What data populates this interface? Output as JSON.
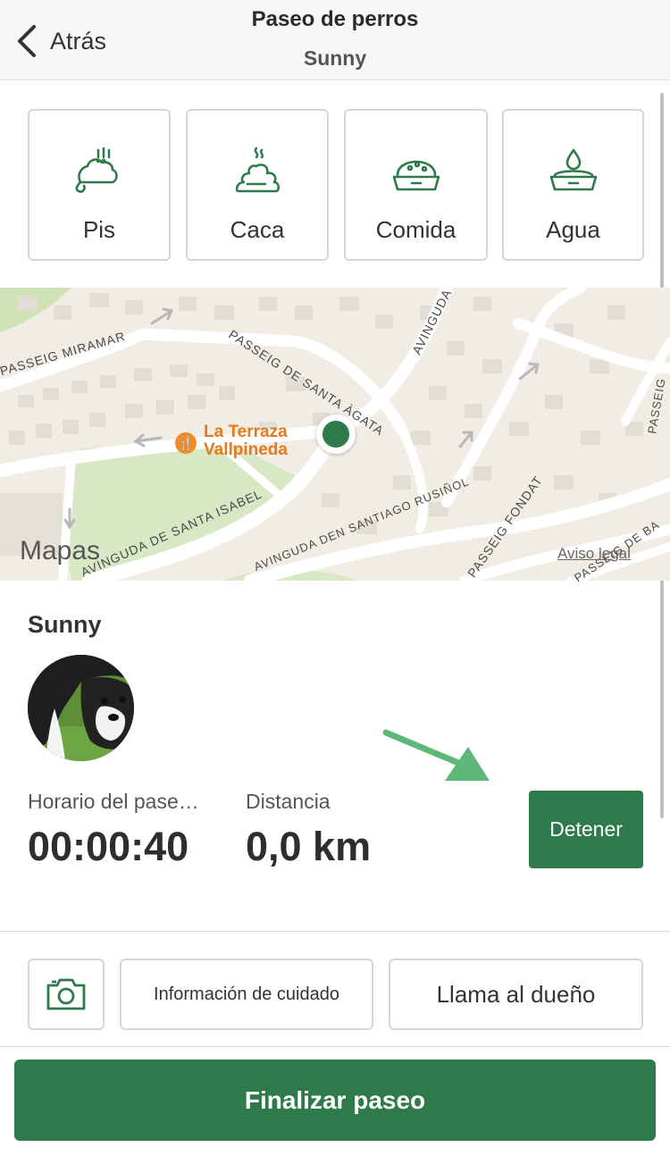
{
  "header": {
    "back_label": "Atrás",
    "title": "Paseo de perros",
    "subtitle": "Sunny"
  },
  "actions": [
    {
      "label": "Pis",
      "icon": "pee-icon"
    },
    {
      "label": "Caca",
      "icon": "poop-icon"
    },
    {
      "label": "Comida",
      "icon": "food-bowl-icon"
    },
    {
      "label": "Agua",
      "icon": "water-bowl-icon"
    }
  ],
  "map": {
    "streets": [
      "PASSEIG MIRAMAR",
      "PASSEIG DE SANTA ÀGATA",
      "AVINGUDA",
      "AVINGUDA DE SANTA ISABEL",
      "AVINGUDA DEN SANTIAGO RUSIÑOL",
      "PASSEIG FONDAT",
      "PASSEIG DE BA",
      "PASSEIG"
    ],
    "poi": "La Terraza Vallpineda",
    "brand": "Mapas",
    "legal": "Aviso legal"
  },
  "dog": {
    "name": "Sunny"
  },
  "stats": {
    "time_label": "Horario del pase…",
    "time_value": "00:00:40",
    "distance_label": "Distancia",
    "distance_value": "0,0 km"
  },
  "buttons": {
    "stop": "Detener",
    "care_info": "Información de cuidado",
    "call_owner": "Llama al dueño",
    "finish": "Finalizar paseo"
  },
  "colors": {
    "accent": "#2f7a4b",
    "poi": "#e6791e",
    "arrow": "#5db87a"
  }
}
